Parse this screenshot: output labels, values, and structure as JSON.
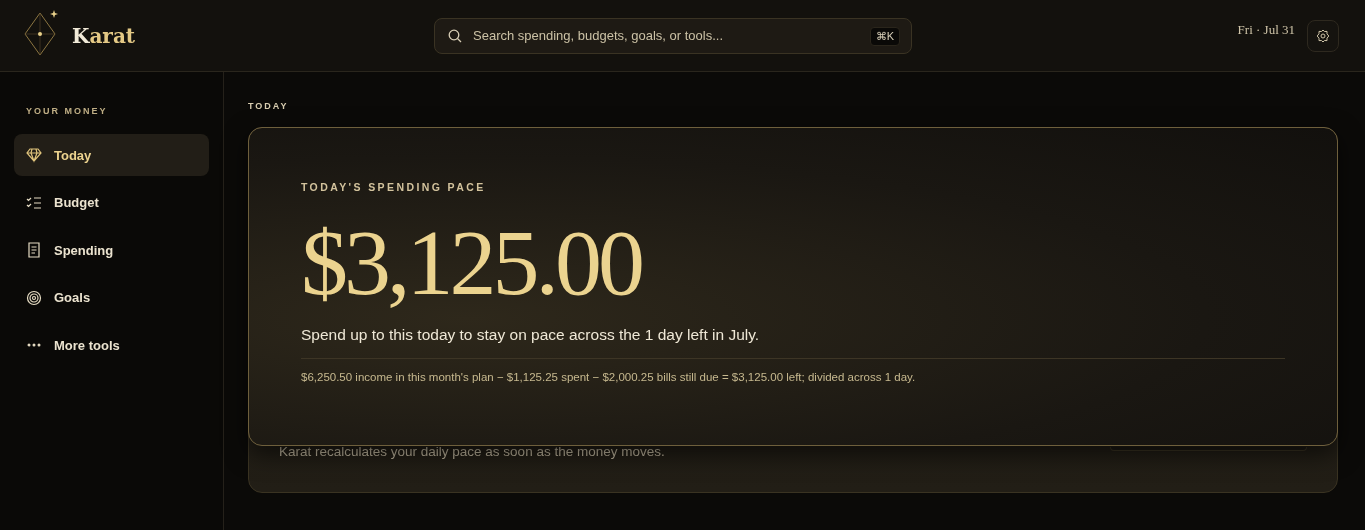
{
  "brand": {
    "name": "Karat"
  },
  "search": {
    "placeholder": "Search spending, budgets, goals, or tools...",
    "shortcut": "⌘K"
  },
  "date": "Fri · Jul 31",
  "sidebar": {
    "heading": "YOUR MONEY",
    "items": [
      {
        "label": "Today",
        "selected": true
      },
      {
        "label": "Budget",
        "selected": false
      },
      {
        "label": "Spending",
        "selected": false
      },
      {
        "label": "Goals",
        "selected": false
      },
      {
        "label": "More tools",
        "selected": false
      }
    ]
  },
  "section_label": "TODAY",
  "hero": {
    "eyebrow": "TODAY'S SPENDING PACE",
    "amount": "$3,125.00",
    "caption": "Spend up to this today to stay on pace across the 1 day left in July.",
    "formula": "$6,250.50 income in this month's plan − $1,125.25 spent − $2,000.25 bills still due = $3,125.00 left; divided across 1 day."
  },
  "note_card": {
    "text": "Karat recalculates your daily pace as soon as the money moves."
  }
}
